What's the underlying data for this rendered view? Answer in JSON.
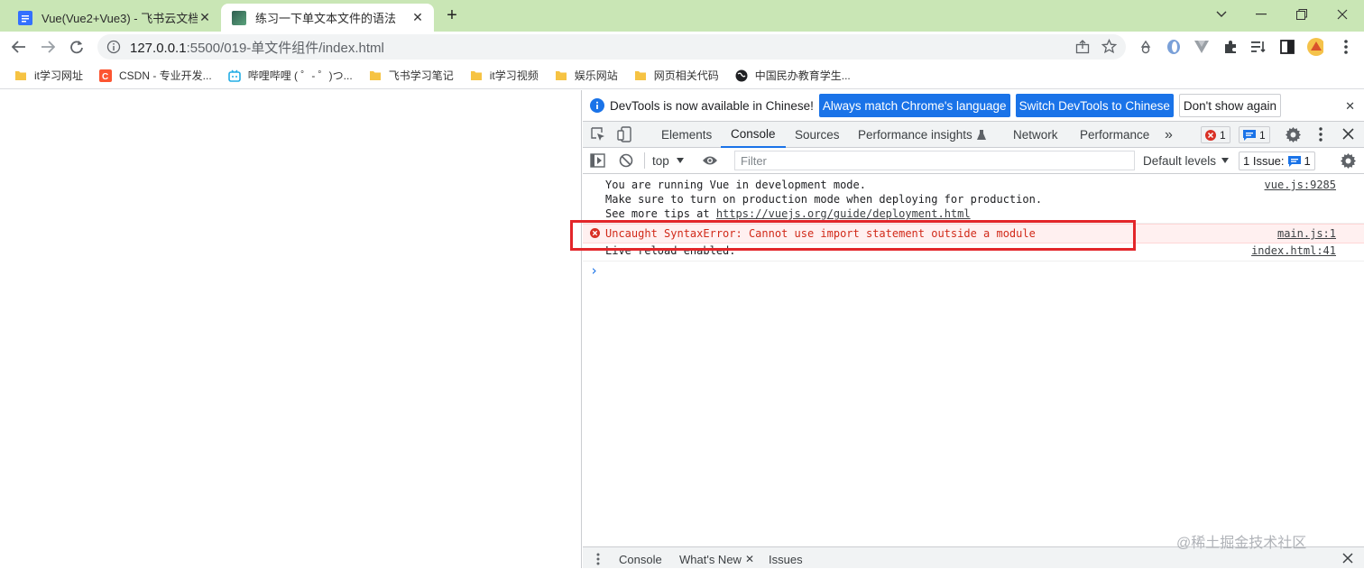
{
  "tabs": [
    {
      "title": "Vue(Vue2+Vue3) - 飞书云文档",
      "active": false
    },
    {
      "title": "练习一下单文本文件的语法",
      "active": true
    }
  ],
  "address": {
    "host": "127.0.0.1",
    "path": ":5500/019-单文件组件/index.html"
  },
  "bookmarks": [
    {
      "label": "it学习网址",
      "icon": "folder-icon"
    },
    {
      "label": "CSDN - 专业开发...",
      "icon": "csdn-icon"
    },
    {
      "label": "哔哩哔哩 ( ゜- ゜)つ...",
      "icon": "bilibili-icon"
    },
    {
      "label": "飞书学习笔记",
      "icon": "folder-icon"
    },
    {
      "label": "it学习视频",
      "icon": "folder-icon"
    },
    {
      "label": "娱乐网站",
      "icon": "folder-icon"
    },
    {
      "label": "网页相关代码",
      "icon": "folder-icon"
    },
    {
      "label": "中国民办教育学生...",
      "icon": "globe-icon"
    }
  ],
  "infobar": {
    "message": "DevTools is now available in Chinese!",
    "btn_match": "Always match Chrome's language",
    "btn_switch": "Switch DevTools to Chinese",
    "btn_dismiss": "Don't show again"
  },
  "devtabs": {
    "elements": "Elements",
    "console": "Console",
    "sources": "Sources",
    "perf_insights": "Performance insights",
    "network": "Network",
    "performance": "Performance",
    "more": "»",
    "error_count": "1",
    "message_count": "1"
  },
  "console_toolbar": {
    "context": "top",
    "filter_placeholder": "Filter",
    "levels": "Default levels",
    "issues_label": "1 Issue:",
    "issues_count": "1"
  },
  "messages": {
    "vue_line1": "You are running Vue in development mode.",
    "vue_line2": "Make sure to turn on production mode when deploying for production.",
    "vue_line3_prefix": "See more tips at ",
    "vue_line3_link": "https://vuejs.org/guide/deployment.html",
    "vue_src": "vue.js:9285",
    "error_text": "Uncaught SyntaxError: Cannot use import statement outside a module",
    "error_src": "main.js:1",
    "reload_text": "Live reload enabled.",
    "reload_src": "index.html:41",
    "prompt": "›"
  },
  "drawer": {
    "console": "Console",
    "whats_new": "What's New",
    "issues": "Issues"
  },
  "watermark": "@稀土掘金技术社区",
  "colors": {
    "tabbar": "#c9e6b5",
    "accent": "#1a73e8",
    "error": "#d12a19",
    "highlight": "#e3262a"
  }
}
